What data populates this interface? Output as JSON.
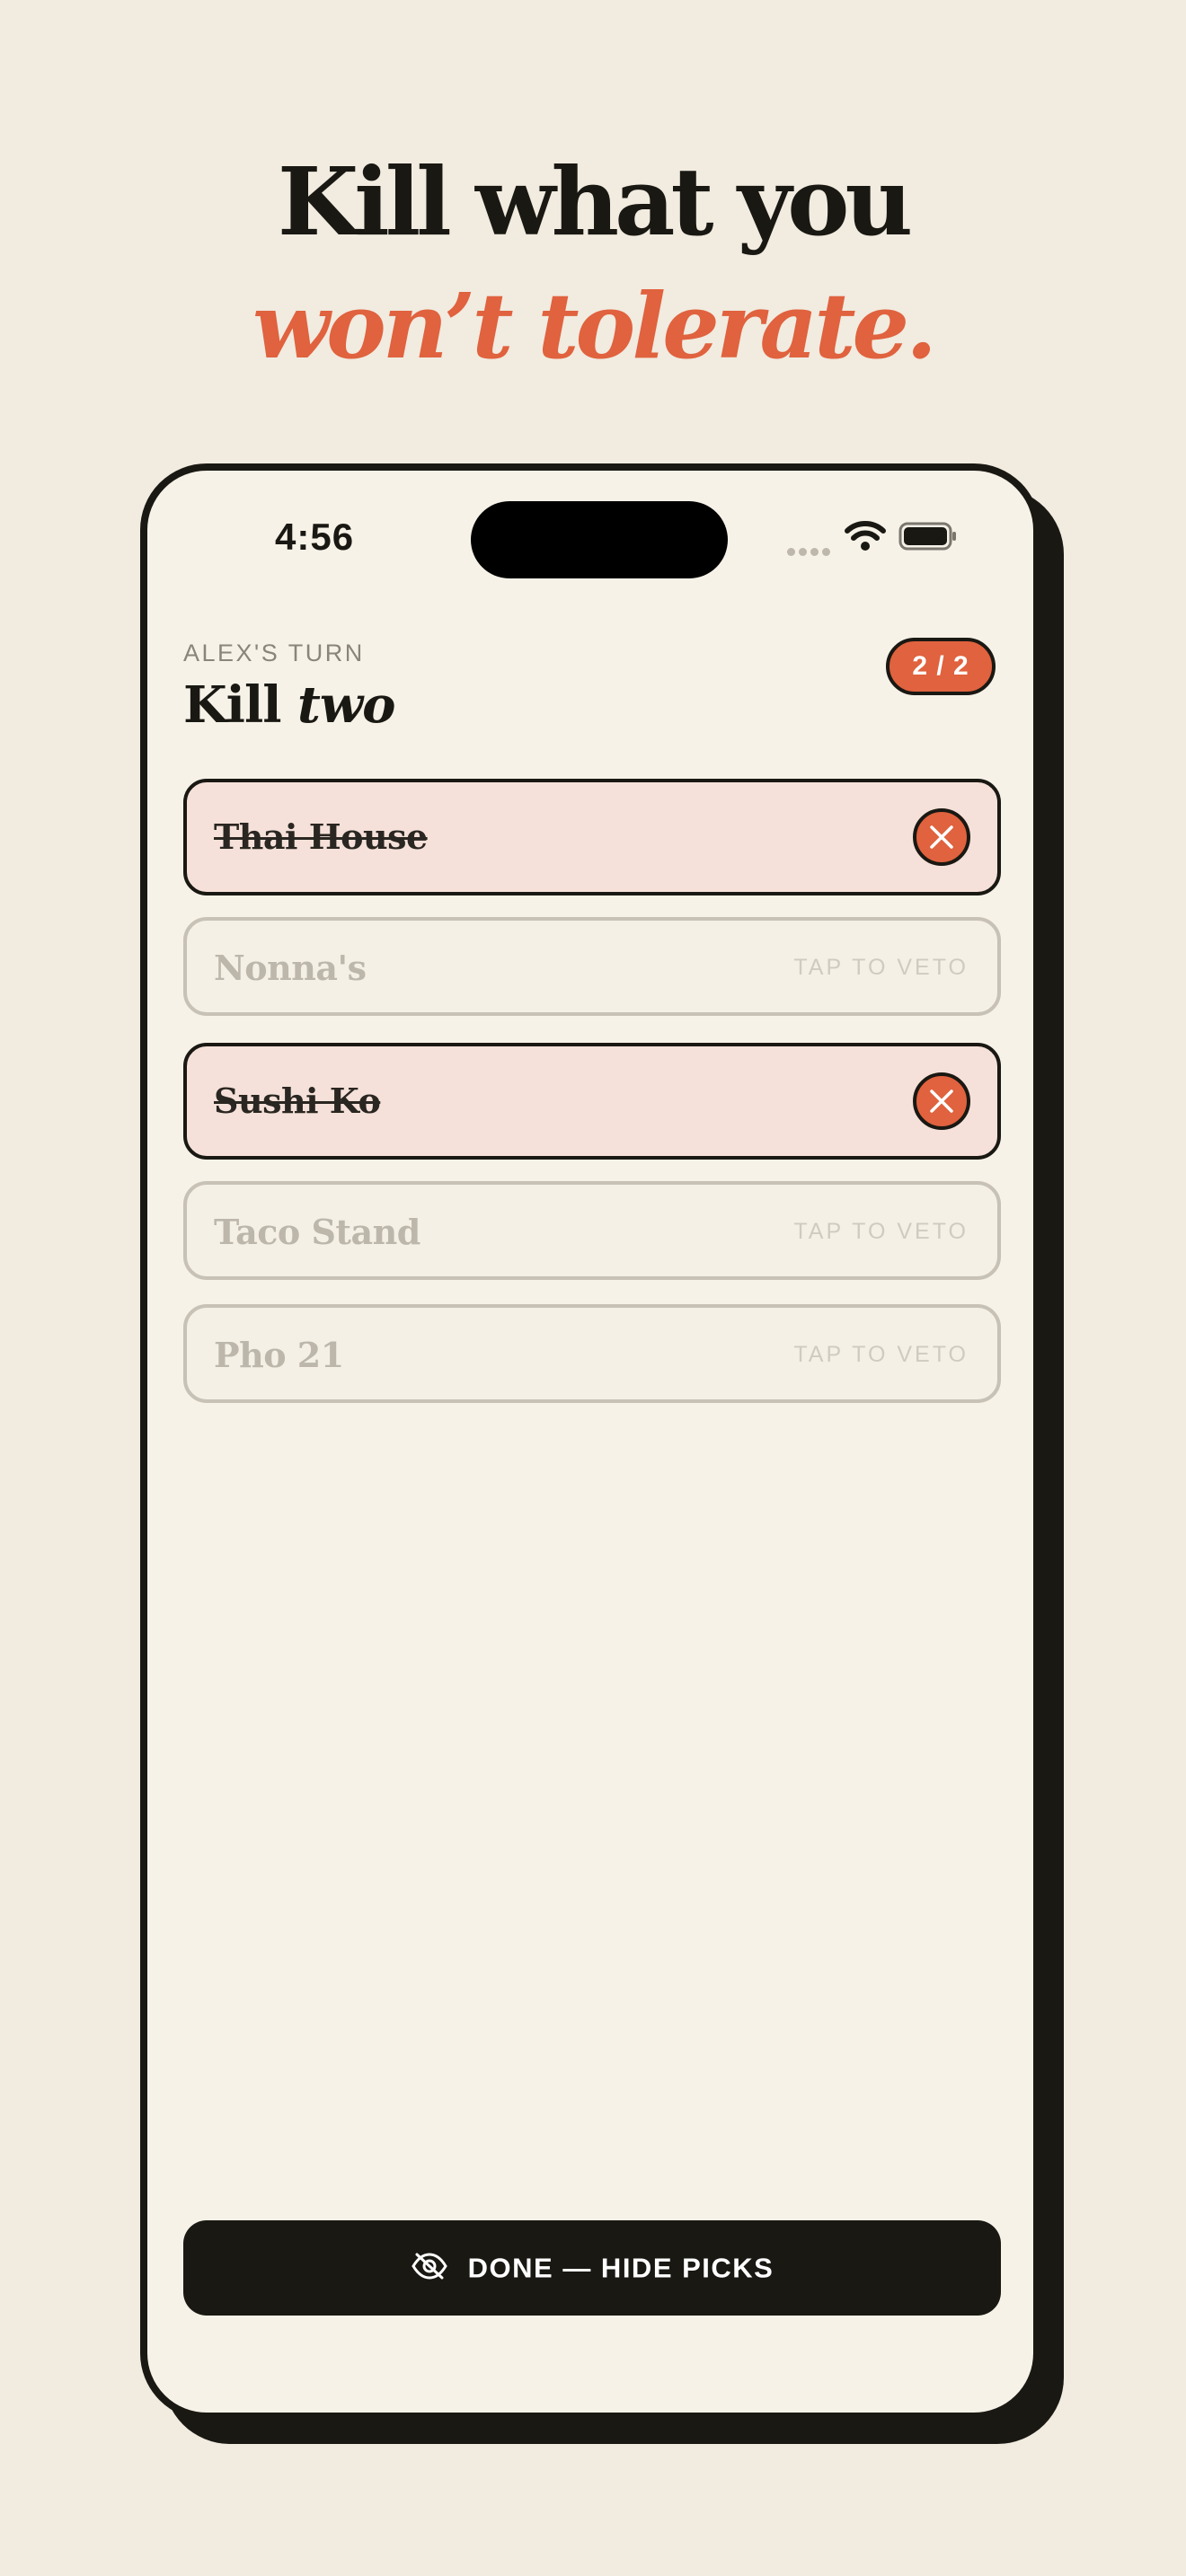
{
  "hero": {
    "line1": "Kill what you",
    "line2": "won’t tolerate."
  },
  "status_bar": {
    "time": "4:56"
  },
  "header": {
    "turn_label": "ALEX'S TURN",
    "title_prefix": "Kill",
    "title_emphasis": "two",
    "counter": "2 / 2"
  },
  "options": [
    {
      "name": "Thai House",
      "vetoed": true
    },
    {
      "name": "Nonna's",
      "vetoed": false,
      "hint": "TAP TO VETO"
    },
    {
      "name": "Sushi Ko",
      "vetoed": true
    },
    {
      "name": "Taco Stand",
      "vetoed": false,
      "hint": "TAP TO VETO"
    },
    {
      "name": "Pho 21",
      "vetoed": false,
      "hint": "TAP TO VETO"
    }
  ],
  "done_button": {
    "label": "DONE — HIDE PICKS",
    "icon": "eye-slash-icon"
  },
  "colors": {
    "background": "#f1ebe0",
    "accent": "#e0623e",
    "ink": "#1a1813",
    "vetoed_fill": "#f5e1d9"
  }
}
